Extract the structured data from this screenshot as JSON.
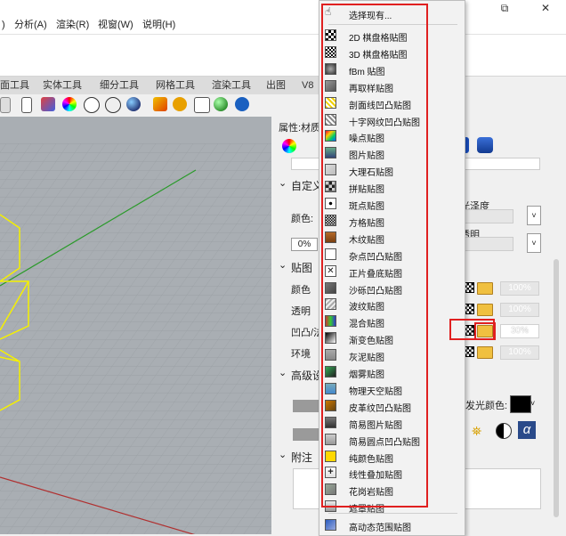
{
  "window": {
    "restore_glyph": "⧉",
    "close_glyph": "✕"
  },
  "menubar": [
    {
      "label": ")"
    },
    {
      "label": "分析(A)"
    },
    {
      "label": "渲染(R)"
    },
    {
      "label": "视窗(W)"
    },
    {
      "label": "说明(H)"
    }
  ],
  "tabs": [
    {
      "label": "面工具"
    },
    {
      "label": "实体工具"
    },
    {
      "label": "细分工具"
    },
    {
      "label": "网格工具"
    },
    {
      "label": "渲染工具"
    },
    {
      "label": "出图"
    },
    {
      "label": "V8"
    }
  ],
  "panel": {
    "header": "属性:材质",
    "section_custom": "自定义",
    "color_label": "颜色:",
    "roughness_label": "光泽度",
    "transparent_label": "透明",
    "pct_value": "0%",
    "section_maps": "贴图",
    "maps": [
      {
        "label": "颜色",
        "value": "100%"
      },
      {
        "label": "透明",
        "value": "100%"
      },
      {
        "label": "凹凸/法",
        "value": "30%"
      },
      {
        "label": "环境",
        "value": "100%"
      }
    ],
    "section_advanced": "高级设",
    "emission_label": "发光颜色:",
    "section_notes": "附注"
  },
  "menu": {
    "header": "选择现有...",
    "items": [
      {
        "label": "2D 棋盘格贴图",
        "icon": "checker-2d-icon"
      },
      {
        "label": "3D 棋盘格贴图",
        "icon": "checker-3d-icon"
      },
      {
        "label": "fBm 贴图",
        "icon": "fbm-icon"
      },
      {
        "label": "再取样贴图",
        "icon": "resample-icon"
      },
      {
        "label": "剖面线凹凸贴图",
        "icon": "hatch-bump-icon"
      },
      {
        "label": "十字网纹凹凸贴图",
        "icon": "crosshatch-bump-icon"
      },
      {
        "label": "噪点贴图",
        "icon": "noise-icon"
      },
      {
        "label": "图片贴图",
        "icon": "image-icon"
      },
      {
        "label": "大理石贴图",
        "icon": "marble-icon"
      },
      {
        "label": "拼贴贴图",
        "icon": "tile-icon"
      },
      {
        "label": "斑点贴图",
        "icon": "dots-icon"
      },
      {
        "label": "方格贴图",
        "icon": "grid-icon"
      },
      {
        "label": "木纹贴图",
        "icon": "wood-icon"
      },
      {
        "label": "杂点凹凸贴图",
        "icon": "speckle-bump-icon"
      },
      {
        "label": "正片叠底贴图",
        "icon": "multiply-icon"
      },
      {
        "label": "沙砾凹凸贴图",
        "icon": "gravel-bump-icon"
      },
      {
        "label": "波纹贴图",
        "icon": "wave-icon"
      },
      {
        "label": "混合贴图",
        "icon": "blend-icon"
      },
      {
        "label": "渐变色贴图",
        "icon": "gradient-icon"
      },
      {
        "label": "灰泥贴图",
        "icon": "stucco-icon"
      },
      {
        "label": "烟雾贴图",
        "icon": "smoke-icon"
      },
      {
        "label": "物理天空贴图",
        "icon": "sky-icon"
      },
      {
        "label": "皮革纹凹凸贴图",
        "icon": "leather-bump-icon"
      },
      {
        "label": "简易图片贴图",
        "icon": "simple-image-icon"
      },
      {
        "label": "简易圆点凹凸贴图",
        "icon": "simple-dot-bump-icon"
      },
      {
        "label": "纯颜色贴图",
        "icon": "solid-color-icon"
      },
      {
        "label": "线性叠加贴图",
        "icon": "linear-add-icon"
      },
      {
        "label": "花岗岩贴图",
        "icon": "granite-icon"
      },
      {
        "label": "遮罩贴图",
        "icon": "mask-icon"
      },
      {
        "label": "高动态范围贴图",
        "icon": "hdr-icon"
      }
    ]
  }
}
